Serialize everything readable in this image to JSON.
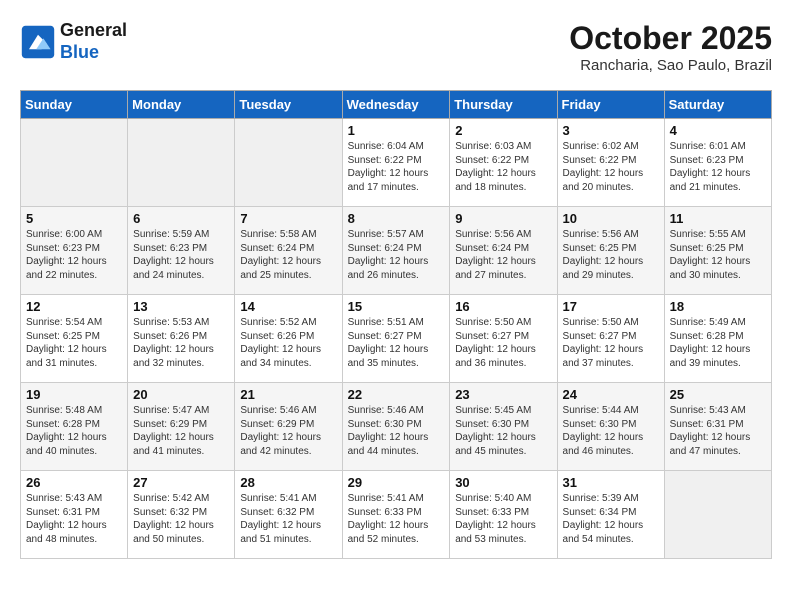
{
  "header": {
    "logo_line1": "General",
    "logo_line2": "Blue",
    "month": "October 2025",
    "location": "Rancharia, Sao Paulo, Brazil"
  },
  "weekdays": [
    "Sunday",
    "Monday",
    "Tuesday",
    "Wednesday",
    "Thursday",
    "Friday",
    "Saturday"
  ],
  "weeks": [
    [
      {
        "day": "",
        "info": ""
      },
      {
        "day": "",
        "info": ""
      },
      {
        "day": "",
        "info": ""
      },
      {
        "day": "1",
        "info": "Sunrise: 6:04 AM\nSunset: 6:22 PM\nDaylight: 12 hours\nand 17 minutes."
      },
      {
        "day": "2",
        "info": "Sunrise: 6:03 AM\nSunset: 6:22 PM\nDaylight: 12 hours\nand 18 minutes."
      },
      {
        "day": "3",
        "info": "Sunrise: 6:02 AM\nSunset: 6:22 PM\nDaylight: 12 hours\nand 20 minutes."
      },
      {
        "day": "4",
        "info": "Sunrise: 6:01 AM\nSunset: 6:23 PM\nDaylight: 12 hours\nand 21 minutes."
      }
    ],
    [
      {
        "day": "5",
        "info": "Sunrise: 6:00 AM\nSunset: 6:23 PM\nDaylight: 12 hours\nand 22 minutes."
      },
      {
        "day": "6",
        "info": "Sunrise: 5:59 AM\nSunset: 6:23 PM\nDaylight: 12 hours\nand 24 minutes."
      },
      {
        "day": "7",
        "info": "Sunrise: 5:58 AM\nSunset: 6:24 PM\nDaylight: 12 hours\nand 25 minutes."
      },
      {
        "day": "8",
        "info": "Sunrise: 5:57 AM\nSunset: 6:24 PM\nDaylight: 12 hours\nand 26 minutes."
      },
      {
        "day": "9",
        "info": "Sunrise: 5:56 AM\nSunset: 6:24 PM\nDaylight: 12 hours\nand 27 minutes."
      },
      {
        "day": "10",
        "info": "Sunrise: 5:56 AM\nSunset: 6:25 PM\nDaylight: 12 hours\nand 29 minutes."
      },
      {
        "day": "11",
        "info": "Sunrise: 5:55 AM\nSunset: 6:25 PM\nDaylight: 12 hours\nand 30 minutes."
      }
    ],
    [
      {
        "day": "12",
        "info": "Sunrise: 5:54 AM\nSunset: 6:25 PM\nDaylight: 12 hours\nand 31 minutes."
      },
      {
        "day": "13",
        "info": "Sunrise: 5:53 AM\nSunset: 6:26 PM\nDaylight: 12 hours\nand 32 minutes."
      },
      {
        "day": "14",
        "info": "Sunrise: 5:52 AM\nSunset: 6:26 PM\nDaylight: 12 hours\nand 34 minutes."
      },
      {
        "day": "15",
        "info": "Sunrise: 5:51 AM\nSunset: 6:27 PM\nDaylight: 12 hours\nand 35 minutes."
      },
      {
        "day": "16",
        "info": "Sunrise: 5:50 AM\nSunset: 6:27 PM\nDaylight: 12 hours\nand 36 minutes."
      },
      {
        "day": "17",
        "info": "Sunrise: 5:50 AM\nSunset: 6:27 PM\nDaylight: 12 hours\nand 37 minutes."
      },
      {
        "day": "18",
        "info": "Sunrise: 5:49 AM\nSunset: 6:28 PM\nDaylight: 12 hours\nand 39 minutes."
      }
    ],
    [
      {
        "day": "19",
        "info": "Sunrise: 5:48 AM\nSunset: 6:28 PM\nDaylight: 12 hours\nand 40 minutes."
      },
      {
        "day": "20",
        "info": "Sunrise: 5:47 AM\nSunset: 6:29 PM\nDaylight: 12 hours\nand 41 minutes."
      },
      {
        "day": "21",
        "info": "Sunrise: 5:46 AM\nSunset: 6:29 PM\nDaylight: 12 hours\nand 42 minutes."
      },
      {
        "day": "22",
        "info": "Sunrise: 5:46 AM\nSunset: 6:30 PM\nDaylight: 12 hours\nand 44 minutes."
      },
      {
        "day": "23",
        "info": "Sunrise: 5:45 AM\nSunset: 6:30 PM\nDaylight: 12 hours\nand 45 minutes."
      },
      {
        "day": "24",
        "info": "Sunrise: 5:44 AM\nSunset: 6:30 PM\nDaylight: 12 hours\nand 46 minutes."
      },
      {
        "day": "25",
        "info": "Sunrise: 5:43 AM\nSunset: 6:31 PM\nDaylight: 12 hours\nand 47 minutes."
      }
    ],
    [
      {
        "day": "26",
        "info": "Sunrise: 5:43 AM\nSunset: 6:31 PM\nDaylight: 12 hours\nand 48 minutes."
      },
      {
        "day": "27",
        "info": "Sunrise: 5:42 AM\nSunset: 6:32 PM\nDaylight: 12 hours\nand 50 minutes."
      },
      {
        "day": "28",
        "info": "Sunrise: 5:41 AM\nSunset: 6:32 PM\nDaylight: 12 hours\nand 51 minutes."
      },
      {
        "day": "29",
        "info": "Sunrise: 5:41 AM\nSunset: 6:33 PM\nDaylight: 12 hours\nand 52 minutes."
      },
      {
        "day": "30",
        "info": "Sunrise: 5:40 AM\nSunset: 6:33 PM\nDaylight: 12 hours\nand 53 minutes."
      },
      {
        "day": "31",
        "info": "Sunrise: 5:39 AM\nSunset: 6:34 PM\nDaylight: 12 hours\nand 54 minutes."
      },
      {
        "day": "",
        "info": ""
      }
    ]
  ]
}
